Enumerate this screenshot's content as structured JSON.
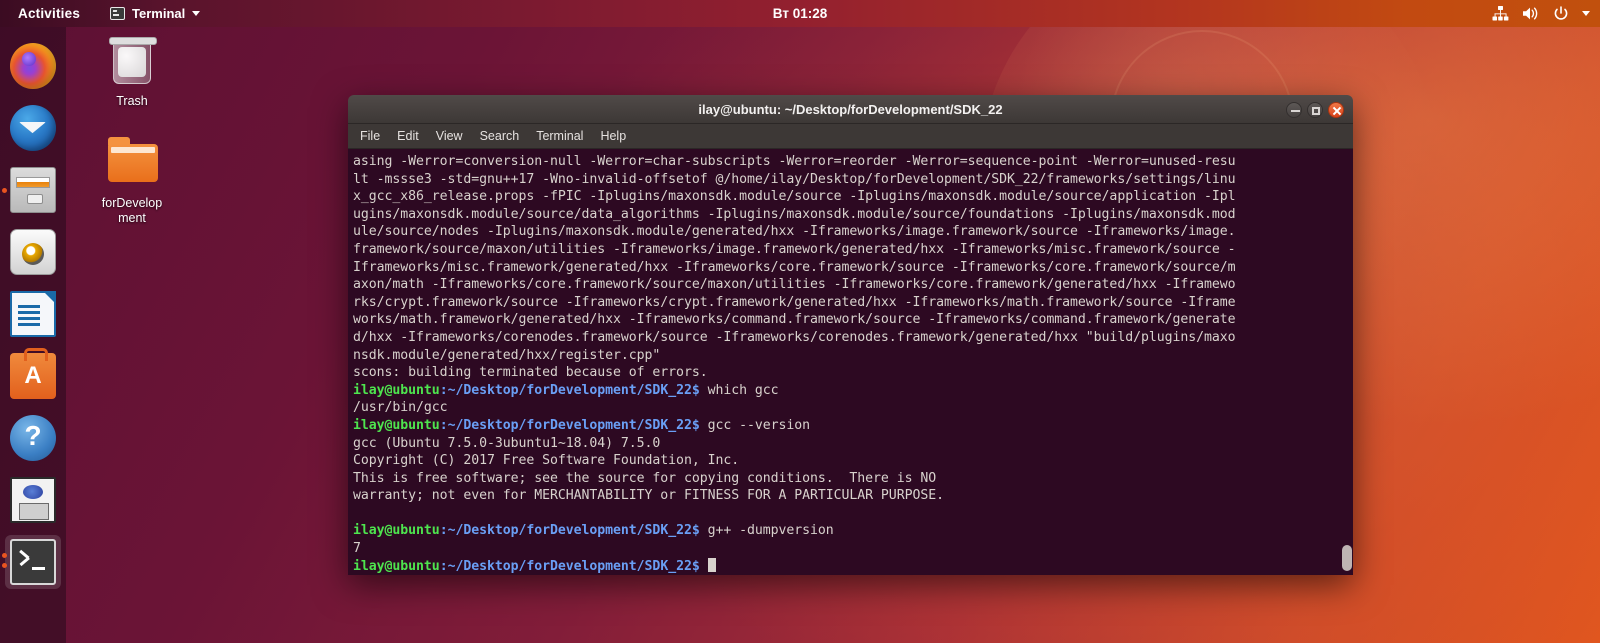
{
  "topbar": {
    "activities": "Activities",
    "app_name": "Terminal",
    "app_icon": "terminal-icon",
    "clock": "Вт 01:28",
    "tray_icons": [
      "network-icon",
      "volume-icon",
      "power-icon",
      "chevron-down-icon"
    ]
  },
  "dock": {
    "items": [
      {
        "name": "firefox",
        "label": "Firefox",
        "running": false
      },
      {
        "name": "thunderbird",
        "label": "Thunderbird",
        "running": false
      },
      {
        "name": "files",
        "label": "Files",
        "running": true
      },
      {
        "name": "rhythmbox",
        "label": "Rhythmbox",
        "running": false
      },
      {
        "name": "libreoffice-writer",
        "label": "LibreOffice Writer",
        "running": false
      },
      {
        "name": "ubuntu-software",
        "label": "Ubuntu Software",
        "running": false
      },
      {
        "name": "help",
        "label": "Help",
        "running": false
      },
      {
        "name": "disks",
        "label": "Disks",
        "running": false
      },
      {
        "name": "terminal",
        "label": "Terminal",
        "running": true
      }
    ]
  },
  "desktop_icons": [
    {
      "name": "trash",
      "label": "Trash"
    },
    {
      "name": "fordevelopment-folder",
      "label": "forDevelop\nment"
    }
  ],
  "window": {
    "title": "ilay@ubuntu: ~/Desktop/forDevelopment/SDK_22",
    "menu": [
      "File",
      "Edit",
      "View",
      "Search",
      "Terminal",
      "Help"
    ],
    "buttons": {
      "minimize": "minimize",
      "maximize": "maximize",
      "close": "close"
    }
  },
  "terminal": {
    "prompt": "ilay@ubuntu",
    "prompt_path": ":~/Desktop/forDevelopment/SDK_22$ ",
    "lines": [
      {
        "type": "out",
        "text": "asing -Werror=conversion-null -Werror=char-subscripts -Werror=reorder -Werror=sequence-point -Werror=unused-resu"
      },
      {
        "type": "out",
        "text": "lt -mssse3 -std=gnu++17 -Wno-invalid-offsetof @/home/ilay/Desktop/forDevelopment/SDK_22/frameworks/settings/linu"
      },
      {
        "type": "out",
        "text": "x_gcc_x86_release.props -fPIC -Iplugins/maxonsdk.module/source -Iplugins/maxonsdk.module/source/application -Ipl"
      },
      {
        "type": "out",
        "text": "ugins/maxonsdk.module/source/data_algorithms -Iplugins/maxonsdk.module/source/foundations -Iplugins/maxonsdk.mod"
      },
      {
        "type": "out",
        "text": "ule/source/nodes -Iplugins/maxonsdk.module/generated/hxx -Iframeworks/image.framework/source -Iframeworks/image."
      },
      {
        "type": "out",
        "text": "framework/source/maxon/utilities -Iframeworks/image.framework/generated/hxx -Iframeworks/misc.framework/source -"
      },
      {
        "type": "out",
        "text": "Iframeworks/misc.framework/generated/hxx -Iframeworks/core.framework/source -Iframeworks/core.framework/source/m"
      },
      {
        "type": "out",
        "text": "axon/math -Iframeworks/core.framework/source/maxon/utilities -Iframeworks/core.framework/generated/hxx -Iframewo"
      },
      {
        "type": "out",
        "text": "rks/crypt.framework/source -Iframeworks/crypt.framework/generated/hxx -Iframeworks/math.framework/source -Iframe"
      },
      {
        "type": "out",
        "text": "works/math.framework/generated/hxx -Iframeworks/command.framework/source -Iframeworks/command.framework/generate"
      },
      {
        "type": "out",
        "text": "d/hxx -Iframeworks/corenodes.framework/source -Iframeworks/corenodes.framework/generated/hxx \"build/plugins/maxo"
      },
      {
        "type": "out",
        "text": "nsdk.module/generated/hxx/register.cpp\""
      },
      {
        "type": "out",
        "text": "scons: building terminated because of errors."
      },
      {
        "type": "cmd",
        "text": "which gcc"
      },
      {
        "type": "out",
        "text": "/usr/bin/gcc"
      },
      {
        "type": "cmd",
        "text": "gcc --version"
      },
      {
        "type": "out",
        "text": "gcc (Ubuntu 7.5.0-3ubuntu1~18.04) 7.5.0"
      },
      {
        "type": "out",
        "text": "Copyright (C) 2017 Free Software Foundation, Inc."
      },
      {
        "type": "out",
        "text": "This is free software; see the source for copying conditions.  There is NO"
      },
      {
        "type": "out",
        "text": "warranty; not even for MERCHANTABILITY or FITNESS FOR A PARTICULAR PURPOSE."
      },
      {
        "type": "out",
        "text": ""
      },
      {
        "type": "cmd",
        "text": "g++ -dumpversion"
      },
      {
        "type": "out",
        "text": "7"
      },
      {
        "type": "cursor",
        "text": ""
      }
    ]
  },
  "colors": {
    "terminal_bg": "#2d0922",
    "terminal_fg": "#d8d2cd",
    "prompt_green": "#4ee44e",
    "prompt_blue": "#6a9ff5",
    "accent_orange": "#e95420",
    "titlebar": "#3d3836"
  }
}
